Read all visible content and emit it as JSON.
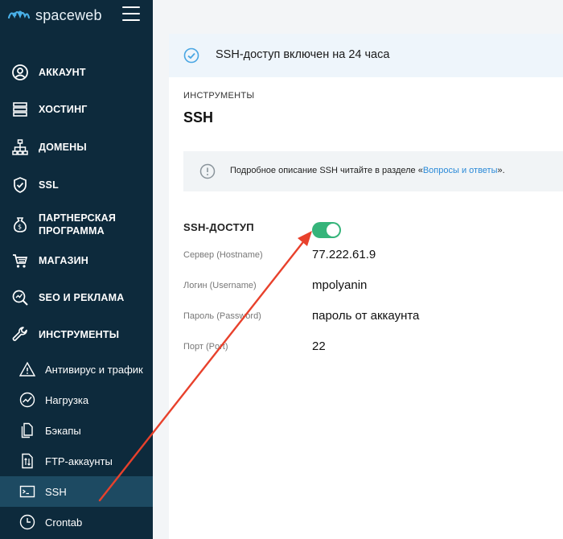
{
  "brand": {
    "name": "spaceweb"
  },
  "sidebar": {
    "items": [
      {
        "label": "АККАУНТ",
        "icon": "user-circle-icon"
      },
      {
        "label": "ХОСТИНГ",
        "icon": "server-icon"
      },
      {
        "label": "ДОМЕНЫ",
        "icon": "sitemap-icon"
      },
      {
        "label": "SSL",
        "icon": "shield-check-icon"
      },
      {
        "label": "ПАРТНЕРСКАЯ ПРОГРАММА",
        "icon": "money-bag-icon"
      },
      {
        "label": "МАГАЗИН",
        "icon": "cart-icon"
      },
      {
        "label": "SEO И РЕКЛАМА",
        "icon": "seo-icon"
      },
      {
        "label": "ИНСТРУМЕНТЫ",
        "icon": "wrench-icon"
      }
    ],
    "subitems": [
      {
        "label": "Антивирус и трафик",
        "icon": "warning-icon"
      },
      {
        "label": "Нагрузка",
        "icon": "chart-icon"
      },
      {
        "label": "Бэкапы",
        "icon": "files-icon"
      },
      {
        "label": "FTP-аккаунты",
        "icon": "ftp-icon"
      },
      {
        "label": "SSH",
        "icon": "terminal-icon",
        "active": true
      },
      {
        "label": "Crontab",
        "icon": "clock-icon"
      }
    ]
  },
  "notice": {
    "text": "SSH-доступ включен на 24 часа"
  },
  "page": {
    "section": "ИНСТРУМЕНТЫ",
    "title": "SSH"
  },
  "info": {
    "prefix": "Подробное описание SSH читайте в разделе «",
    "link": "Вопросы и ответы",
    "suffix": "»."
  },
  "ssh": {
    "title": "SSH-ДОСТУП",
    "enabled": true,
    "rows": [
      {
        "label": "Сервер (Hostname)",
        "value": "77.222.61.9"
      },
      {
        "label": "Логин (Username)",
        "value": "mpolyanin"
      },
      {
        "label": "Пароль (Password)",
        "value": "пароль от аккаунта"
      },
      {
        "label": "Порт (Port)",
        "value": "22"
      }
    ]
  },
  "colors": {
    "sidebar": "#0d2a3c",
    "active": "#1d4a62",
    "toggle": "#35b47a",
    "link": "#2b8ad8",
    "arrow": "#e8412c"
  }
}
